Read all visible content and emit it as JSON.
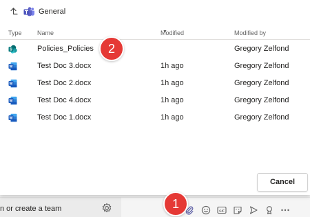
{
  "breadcrumb": {
    "channel": "General"
  },
  "columns": {
    "type": "Type",
    "name": "Name",
    "modified": "Modified",
    "modified_by": "Modified by"
  },
  "files": [
    {
      "name": "Policies_Policies",
      "modified": "",
      "modified_by": "Gregory Zelfond",
      "icon": "sharepoint-site-icon"
    },
    {
      "name": "Test Doc 3.docx",
      "modified": "1h ago",
      "modified_by": "Gregory Zelfond",
      "icon": "word-doc-icon"
    },
    {
      "name": "Test Doc 2.docx",
      "modified": "1h ago",
      "modified_by": "Gregory Zelfond",
      "icon": "word-doc-icon"
    },
    {
      "name": "Test Doc 4.docx",
      "modified": "1h ago",
      "modified_by": "Gregory Zelfond",
      "icon": "word-doc-icon"
    },
    {
      "name": "Test Doc 1.docx",
      "modified": "1h ago",
      "modified_by": "Gregory Zelfond",
      "icon": "word-doc-icon"
    }
  ],
  "dialog": {
    "cancel_label": "Cancel"
  },
  "footer": {
    "join_text": "n or create a team"
  },
  "annotations": {
    "badge_1": "1",
    "badge_2": "2"
  },
  "colors": {
    "word_blue": "#185abd",
    "badge_red": "#e53935",
    "teams_purple": "#5b5fc7",
    "attach_blue": "#6264a7"
  }
}
